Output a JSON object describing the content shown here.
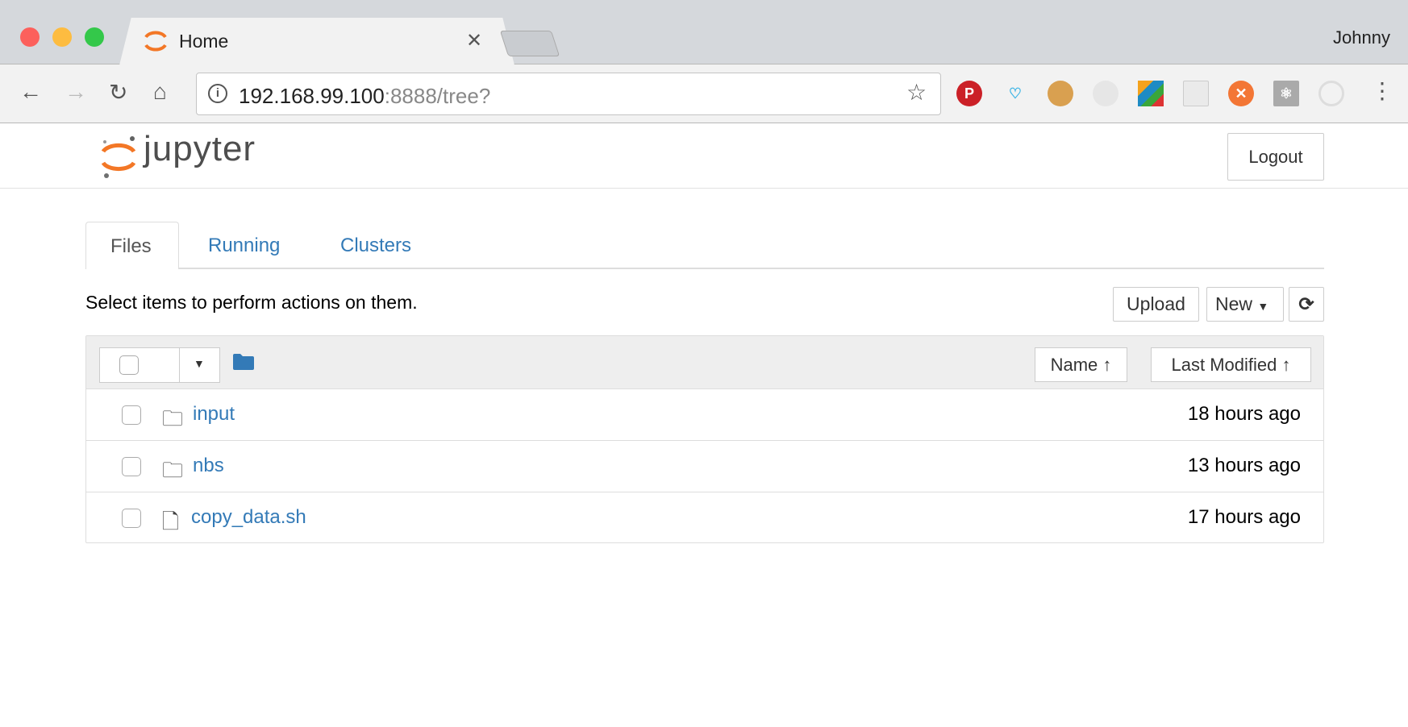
{
  "browser": {
    "tab_title": "Home",
    "user": "Johnny",
    "url_host": "192.168.99.100",
    "url_rest": ":8888/tree?",
    "extensions": [
      "pinterest-icon",
      "shopping-heart-icon",
      "cookie-icon",
      "json-viewer-icon",
      "avg-icon",
      "discover-devtools-icon",
      "postman-icon",
      "react-devtools-icon",
      "ionic-icon"
    ],
    "colors": {
      "pinterest": "#cb2027",
      "postman": "#f37635",
      "react": "#aaaaaa"
    }
  },
  "header": {
    "logo_text": "jupyter",
    "logout_label": "Logout"
  },
  "tabs": [
    {
      "label": "Files",
      "active": true
    },
    {
      "label": "Running"
    },
    {
      "label": "Clusters"
    }
  ],
  "toolbar": {
    "hint": "Select items to perform actions on them.",
    "upload_label": "Upload",
    "new_label": "New",
    "refresh_icon": "refresh-icon"
  },
  "list": {
    "sort_name": "Name",
    "sort_modified": "Last Modified",
    "items": [
      {
        "name": "input",
        "type": "folder",
        "modified": "18 hours ago"
      },
      {
        "name": "nbs",
        "type": "folder",
        "modified": "13 hours ago"
      },
      {
        "name": "copy_data.sh",
        "type": "file",
        "modified": "17 hours ago"
      }
    ]
  },
  "colors": {
    "link": "#337ab7",
    "jupyter_orange": "#f37726"
  }
}
